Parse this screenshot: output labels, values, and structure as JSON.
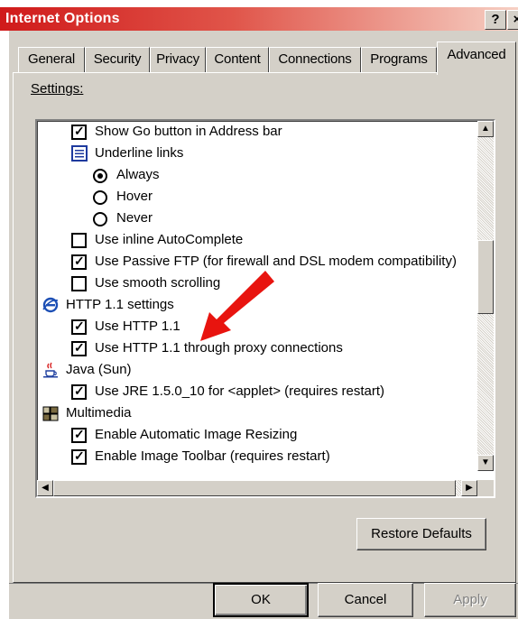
{
  "window": {
    "title": "Internet Options",
    "help_label": "?",
    "close_label": "×"
  },
  "tabs": [
    {
      "label": "General"
    },
    {
      "label": "Security"
    },
    {
      "label": "Privacy"
    },
    {
      "label": "Content"
    },
    {
      "label": "Connections"
    },
    {
      "label": "Programs"
    },
    {
      "label": "Advanced",
      "active": true
    }
  ],
  "settings": {
    "label": "Settings:",
    "items": [
      {
        "kind": "checkbox",
        "checked": true,
        "label": "Show Go button in Address bar"
      },
      {
        "kind": "group-icon",
        "icon": "list-settings-icon",
        "label": "Underline links"
      },
      {
        "kind": "radio",
        "checked": true,
        "label": "Always"
      },
      {
        "kind": "radio",
        "checked": false,
        "label": "Hover"
      },
      {
        "kind": "radio",
        "checked": false,
        "label": "Never"
      },
      {
        "kind": "checkbox",
        "checked": false,
        "label": "Use inline AutoComplete"
      },
      {
        "kind": "checkbox",
        "checked": true,
        "label": "Use Passive FTP (for firewall and DSL modem compatibility)"
      },
      {
        "kind": "checkbox",
        "checked": false,
        "label": "Use smooth scrolling"
      },
      {
        "kind": "group",
        "icon": "internet-explorer-icon",
        "label": "HTTP 1.1 settings"
      },
      {
        "kind": "checkbox",
        "checked": true,
        "label": "Use HTTP 1.1"
      },
      {
        "kind": "checkbox",
        "checked": true,
        "label": "Use HTTP 1.1 through proxy connections"
      },
      {
        "kind": "group",
        "icon": "java-cup-icon",
        "label": "Java (Sun)"
      },
      {
        "kind": "checkbox",
        "checked": true,
        "label": "Use JRE 1.5.0_10 for <applet> (requires restart)"
      },
      {
        "kind": "group",
        "icon": "multimedia-icon",
        "label": "Multimedia"
      },
      {
        "kind": "checkbox",
        "checked": true,
        "label": "Enable Automatic Image Resizing"
      },
      {
        "kind": "checkbox",
        "checked": true,
        "label": "Enable Image Toolbar (requires restart)"
      }
    ]
  },
  "buttons": {
    "restore_defaults": "Restore Defaults",
    "ok": "OK",
    "cancel": "Cancel",
    "apply": "Apply"
  },
  "colors": {
    "titlebar_start": "#d01a1a",
    "annotation_arrow": "#e8140f",
    "face": "#d4d0c8"
  }
}
